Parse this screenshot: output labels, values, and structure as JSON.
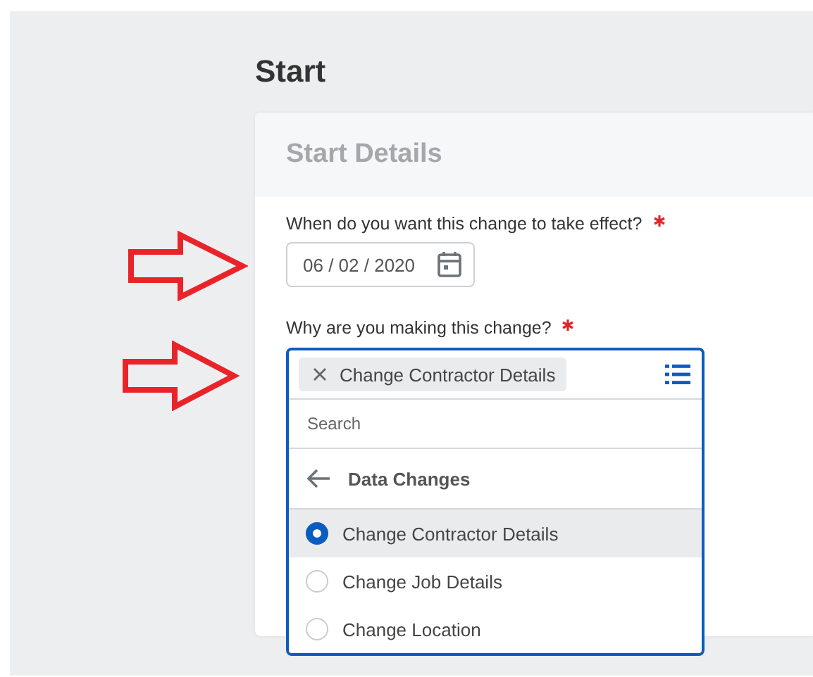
{
  "page_title": "Start",
  "section": {
    "title": "Start Details"
  },
  "date_field": {
    "label": "When do you want this change to take effect?",
    "required": true,
    "value": "06 / 02 / 2020"
  },
  "reason_field": {
    "label": "Why are you making this change?",
    "required": true,
    "chips": [
      {
        "label": "Change Contractor Details"
      }
    ],
    "search": {
      "placeholder": "Search"
    },
    "category": "Data Changes",
    "options": [
      {
        "label": "Change Contractor Details",
        "selected": true
      },
      {
        "label": "Change Job Details",
        "selected": false
      },
      {
        "label": "Change Location",
        "selected": false
      }
    ]
  }
}
